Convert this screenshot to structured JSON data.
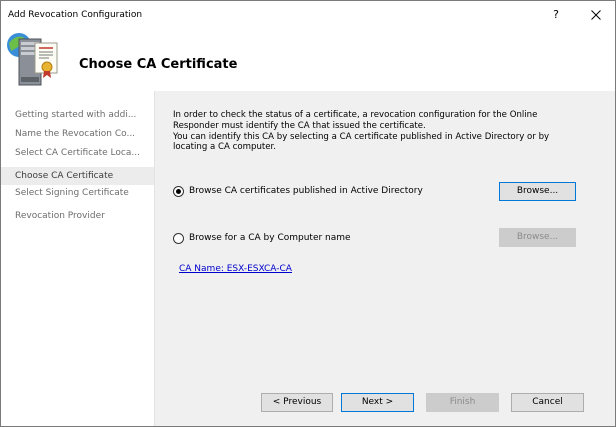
{
  "window": {
    "title": "Add Revocation Configuration",
    "help_label": "?",
    "close_label": "✕"
  },
  "header": {
    "title": "Choose CA Certificate",
    "icon": "certificate-server-icon"
  },
  "nav": {
    "items": [
      {
        "label": "Getting started with addi...",
        "selected": false
      },
      {
        "label": "Name the Revocation Co...",
        "selected": false
      },
      {
        "label": "Select CA Certificate Loca...",
        "selected": false
      },
      {
        "label": "Choose CA Certificate",
        "selected": true
      },
      {
        "label": "Select Signing Certificate",
        "selected": false
      },
      {
        "label": "Revocation Provider",
        "selected": false
      }
    ]
  },
  "content": {
    "description_lines": [
      "In order to check the status of a certificate, a revocation configuration for the Online",
      "Responder must identify the CA that issued the certificate.",
      "You can identify this CA by selecting a CA certificate published in Active Directory or by",
      "locating a CA computer."
    ],
    "option_ad": {
      "label": "Browse CA certificates published in Active Directory",
      "checked": true,
      "button_label": "Browse..."
    },
    "option_computer": {
      "label": "Browse for a CA by Computer name",
      "checked": false,
      "button_label": "Browse..."
    },
    "ca_name_link": "CA Name: ESX-ESXCA-CA"
  },
  "footer": {
    "previous_label": "< Previous",
    "next_label": "Next >",
    "finish_label": "Finish",
    "cancel_label": "Cancel"
  },
  "colors": {
    "accent": "#0078d7",
    "link": "#0000cc",
    "content_bg": "#f0f0f0",
    "nav_selected_bg": "#ececec"
  }
}
